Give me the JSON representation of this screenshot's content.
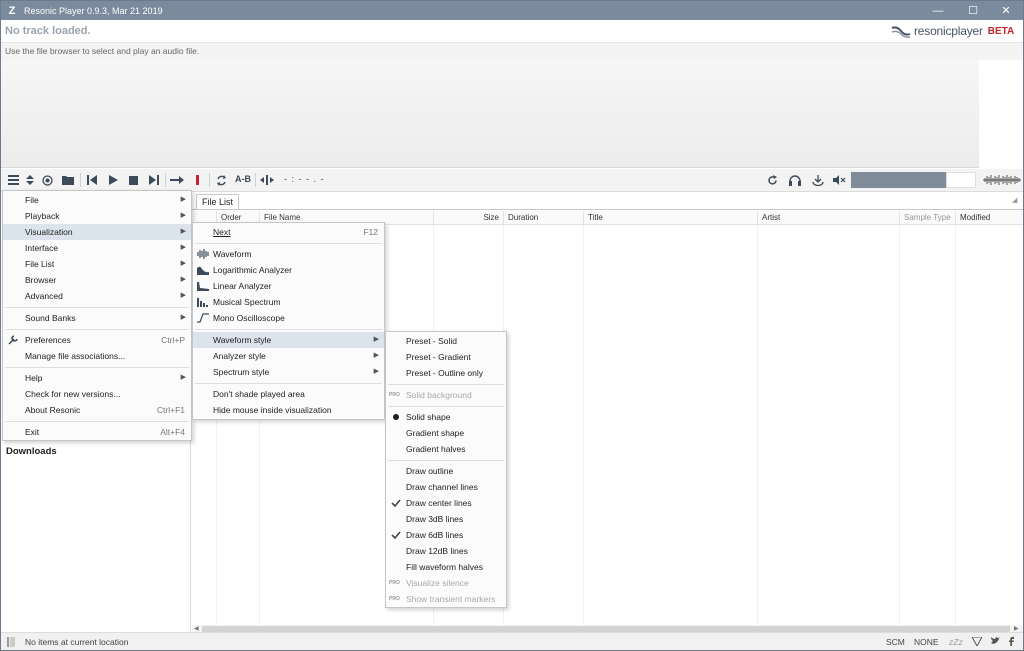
{
  "window": {
    "title": "Resonic Player 0.9.3, Mar 21 2019",
    "minimize_glyph": "—",
    "maximize_glyph": "☐",
    "close_glyph": "✕"
  },
  "track": {
    "status": "No track loaded.",
    "hint": "Use the file browser to select and play an audio file."
  },
  "brand": {
    "name": "resonicplayer",
    "beta": "BETA",
    "color": "#c0262b"
  },
  "toolbar": {
    "ab_label": "A-B",
    "position_text": "- : - - . -",
    "accent_color": "#7f8b98"
  },
  "tabs": {
    "file_list": "File List"
  },
  "columns": {
    "order": "Order",
    "file_name": "File Name",
    "size": "Size",
    "duration": "Duration",
    "title": "Title",
    "artist": "Artist",
    "sample_type": "Sample Type",
    "modified": "Modified"
  },
  "left_panel": {
    "downloads": "Downloads"
  },
  "status": {
    "text": "No items at current location",
    "scm": "SCM",
    "none": "NONE",
    "zzz": "zZz"
  },
  "main_menu": {
    "file": "File",
    "playback": "Playback",
    "visualization": "Visualization",
    "interface": "Interface",
    "file_list": "File List",
    "browser": "Browser",
    "advanced": "Advanced",
    "sound_banks": "Sound Banks",
    "preferences": "Preferences",
    "preferences_shortcut": "Ctrl+P",
    "manage_assoc": "Manage file associations...",
    "help": "Help",
    "check_versions": "Check for new versions...",
    "about": "About Resonic",
    "about_shortcut": "Ctrl+F1",
    "exit": "Exit",
    "exit_shortcut": "Alt+F4"
  },
  "viz_menu": {
    "next": "Next",
    "next_shortcut": "F12",
    "waveform": "Waveform",
    "log_analyzer": "Logarithmic Analyzer",
    "linear_analyzer": "Linear Analyzer",
    "musical_spectrum": "Musical Spectrum",
    "mono_osc": "Mono Oscilloscope",
    "waveform_style": "Waveform style",
    "analyzer_style": "Analyzer style",
    "spectrum_style": "Spectrum style",
    "dont_shade": "Don't shade played area",
    "hide_mouse": "Hide mouse inside visualization"
  },
  "style_menu": {
    "pro_label": "PRO",
    "preset_solid": "Preset - Solid",
    "preset_gradient": "Preset - Gradient",
    "preset_outline": "Preset - Outline only",
    "solid_background": "Solid background",
    "solid_shape": "Solid shape",
    "gradient_shape": "Gradient shape",
    "gradient_halves": "Gradient halves",
    "draw_outline": "Draw outline",
    "draw_channel_lines": "Draw channel lines",
    "draw_center_lines": "Draw center lines",
    "draw_3db": "Draw 3dB lines",
    "draw_6db": "Draw 6dB lines",
    "draw_12db": "Draw 12dB lines",
    "fill_halves": "Fill waveform halves",
    "visualize_silence": "Visualize silence",
    "show_transient": "Show transient markers"
  }
}
